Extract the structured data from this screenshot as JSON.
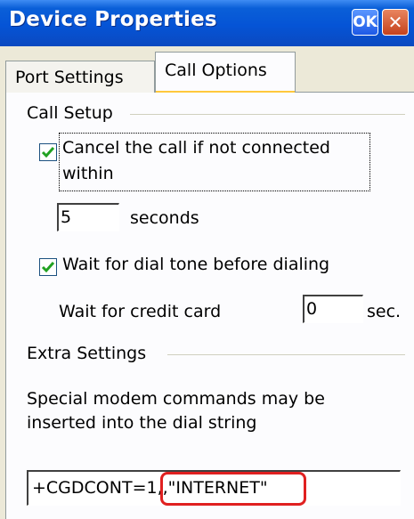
{
  "window": {
    "title": "Device Properties",
    "ok_label": "OK",
    "close_label": "✕"
  },
  "tabs": [
    {
      "label": "Port Settings",
      "selected": false
    },
    {
      "label": "Call Options",
      "selected": true
    }
  ],
  "call_setup": {
    "group_label": "Call Setup",
    "cancel_call": {
      "checked": true,
      "label_line1": "Cancel the call if not connected",
      "label_line2": "within"
    },
    "seconds_value": "5",
    "seconds_label": "seconds",
    "wait_dial_tone": {
      "checked": true,
      "label": "Wait for dial tone before dialing"
    },
    "credit_card_label": "Wait for credit card",
    "credit_card_value": "0",
    "credit_card_unit": "sec."
  },
  "extra_settings": {
    "group_label": "Extra Settings",
    "description_line1": "Special modem commands may be",
    "description_line2": "inserted into the dial string",
    "command_prefix": "+CGDCONT=1,,",
    "command_highlight": "\"INTERNET\""
  },
  "colors": {
    "titlebar": "#0554d6",
    "annotation": "#e02020",
    "checkmark": "#21a121"
  }
}
